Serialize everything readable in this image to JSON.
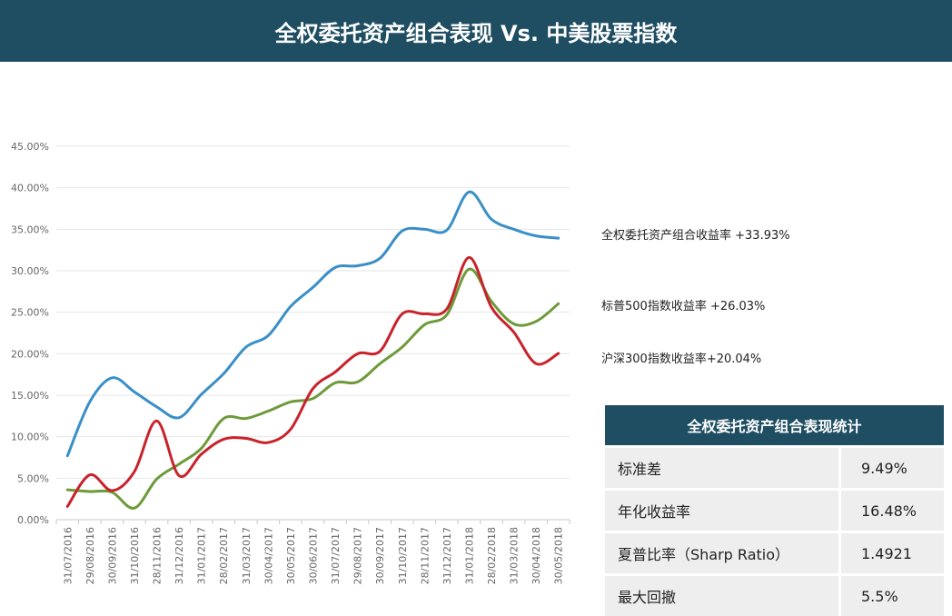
{
  "header": {
    "title": "全权委托资产组合表现 Vs. 中美股票指数"
  },
  "series_labels": {
    "portfolio": "全权委托资产组合收益率 +33.93%",
    "sp500": "标普500指数收益率 +26.03%",
    "csi300": "沪深300指数收益率+20.04%"
  },
  "stats": {
    "title": "全权委托资产组合表现统计",
    "rows": [
      {
        "label": "标准差",
        "value": "9.49%"
      },
      {
        "label": "年化收益率",
        "value": "16.48%"
      },
      {
        "label": "夏普比率（Sharp Ratio）",
        "value": "1.4921"
      },
      {
        "label": "最大回撤",
        "value": "5.5%"
      }
    ]
  },
  "chart_data": {
    "type": "line",
    "x": [
      "31/07/2016",
      "29/08/2016",
      "30/09/2016",
      "31/10/2016",
      "28/11/2016",
      "31/12/2016",
      "31/01/2017",
      "28/02/2017",
      "31/03/2017",
      "30/04/2017",
      "30/05/2017",
      "30/06/2017",
      "31/07/2017",
      "29/08/2017",
      "30/09/2017",
      "31/10/2017",
      "28/11/2017",
      "31/12/2017",
      "31/01/2018",
      "28/02/2018",
      "31/03/2018",
      "30/04/2018",
      "30/05/2018"
    ],
    "ylim": [
      0,
      45
    ],
    "yticks": [
      "0.00%",
      "5.00%",
      "10.00%",
      "15.00%",
      "20.00%",
      "25.00%",
      "30.00%",
      "35.00%",
      "40.00%",
      "45.00%"
    ],
    "grid": true,
    "series": [
      {
        "name": "全权委托资产组合收益率 +33.93%",
        "color": "#3a8fc8",
        "values": [
          7.7,
          14.2,
          17.1,
          15.4,
          13.6,
          12.3,
          15.1,
          17.6,
          20.8,
          22.2,
          25.7,
          28.0,
          30.4,
          30.6,
          31.5,
          34.8,
          35.0,
          34.9,
          39.5,
          36.2,
          35.0,
          34.2,
          33.93
        ]
      },
      {
        "name": "标普500指数收益率 +26.03%",
        "color": "#6e9a3a",
        "values": [
          3.6,
          3.4,
          3.3,
          1.4,
          4.9,
          6.7,
          8.6,
          12.2,
          12.2,
          13.1,
          14.2,
          14.6,
          16.5,
          16.6,
          18.8,
          20.8,
          23.5,
          24.7,
          30.2,
          26.3,
          23.6,
          23.9,
          26.03
        ]
      },
      {
        "name": "沪深300指数收益率+20.04%",
        "color": "#c8232b",
        "values": [
          1.6,
          5.4,
          3.5,
          5.8,
          11.9,
          5.3,
          7.9,
          9.7,
          9.8,
          9.3,
          10.9,
          15.8,
          17.8,
          20.0,
          20.3,
          24.8,
          24.8,
          25.4,
          31.6,
          25.6,
          22.6,
          18.8,
          20.04
        ]
      }
    ]
  }
}
